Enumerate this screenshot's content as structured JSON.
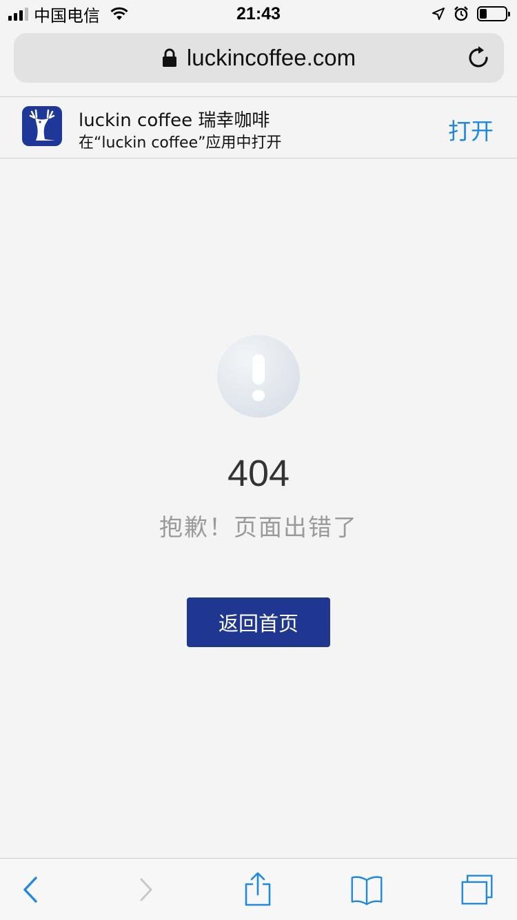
{
  "status_bar": {
    "carrier": "中国电信",
    "time": "21:43",
    "icons": [
      "signal-icon",
      "wifi-icon",
      "location-icon",
      "alarm-icon",
      "battery-icon"
    ]
  },
  "browser": {
    "url": "luckincoffee.com",
    "icons": [
      "lock-icon",
      "reload-icon"
    ]
  },
  "app_banner": {
    "app_name": "luckin coffee 瑞幸咖啡",
    "subtitle": "在“luckin coffee”应用中打开",
    "open_label": "打开",
    "logo_icon": "deer-logo-icon"
  },
  "error": {
    "code": "404",
    "message": "抱歉！页面出错了",
    "icon": "exclamation-icon"
  },
  "home_button": {
    "label": "返回首页"
  },
  "toolbar": {
    "items": [
      "back-icon",
      "forward-icon",
      "share-icon",
      "bookmarks-icon",
      "tabs-icon"
    ]
  },
  "colors": {
    "brand": "#1f3790",
    "link": "#1e88e5",
    "background": "#f4f4f4",
    "message_text": "#9a9a9a",
    "code_text": "#333333"
  }
}
